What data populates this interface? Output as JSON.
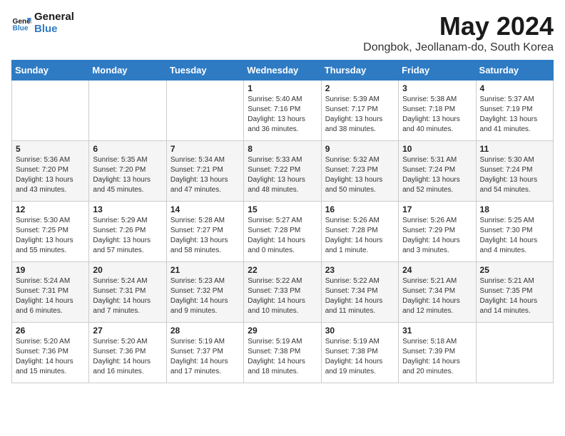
{
  "header": {
    "logo_line1": "General",
    "logo_line2": "Blue",
    "month": "May 2024",
    "location": "Dongbok, Jeollanam-do, South Korea"
  },
  "weekdays": [
    "Sunday",
    "Monday",
    "Tuesday",
    "Wednesday",
    "Thursday",
    "Friday",
    "Saturday"
  ],
  "weeks": [
    [
      {
        "day": "",
        "info": ""
      },
      {
        "day": "",
        "info": ""
      },
      {
        "day": "",
        "info": ""
      },
      {
        "day": "1",
        "info": "Sunrise: 5:40 AM\nSunset: 7:16 PM\nDaylight: 13 hours\nand 36 minutes."
      },
      {
        "day": "2",
        "info": "Sunrise: 5:39 AM\nSunset: 7:17 PM\nDaylight: 13 hours\nand 38 minutes."
      },
      {
        "day": "3",
        "info": "Sunrise: 5:38 AM\nSunset: 7:18 PM\nDaylight: 13 hours\nand 40 minutes."
      },
      {
        "day": "4",
        "info": "Sunrise: 5:37 AM\nSunset: 7:19 PM\nDaylight: 13 hours\nand 41 minutes."
      }
    ],
    [
      {
        "day": "5",
        "info": "Sunrise: 5:36 AM\nSunset: 7:20 PM\nDaylight: 13 hours\nand 43 minutes."
      },
      {
        "day": "6",
        "info": "Sunrise: 5:35 AM\nSunset: 7:20 PM\nDaylight: 13 hours\nand 45 minutes."
      },
      {
        "day": "7",
        "info": "Sunrise: 5:34 AM\nSunset: 7:21 PM\nDaylight: 13 hours\nand 47 minutes."
      },
      {
        "day": "8",
        "info": "Sunrise: 5:33 AM\nSunset: 7:22 PM\nDaylight: 13 hours\nand 48 minutes."
      },
      {
        "day": "9",
        "info": "Sunrise: 5:32 AM\nSunset: 7:23 PM\nDaylight: 13 hours\nand 50 minutes."
      },
      {
        "day": "10",
        "info": "Sunrise: 5:31 AM\nSunset: 7:24 PM\nDaylight: 13 hours\nand 52 minutes."
      },
      {
        "day": "11",
        "info": "Sunrise: 5:30 AM\nSunset: 7:24 PM\nDaylight: 13 hours\nand 54 minutes."
      }
    ],
    [
      {
        "day": "12",
        "info": "Sunrise: 5:30 AM\nSunset: 7:25 PM\nDaylight: 13 hours\nand 55 minutes."
      },
      {
        "day": "13",
        "info": "Sunrise: 5:29 AM\nSunset: 7:26 PM\nDaylight: 13 hours\nand 57 minutes."
      },
      {
        "day": "14",
        "info": "Sunrise: 5:28 AM\nSunset: 7:27 PM\nDaylight: 13 hours\nand 58 minutes."
      },
      {
        "day": "15",
        "info": "Sunrise: 5:27 AM\nSunset: 7:28 PM\nDaylight: 14 hours\nand 0 minutes."
      },
      {
        "day": "16",
        "info": "Sunrise: 5:26 AM\nSunset: 7:28 PM\nDaylight: 14 hours\nand 1 minute."
      },
      {
        "day": "17",
        "info": "Sunrise: 5:26 AM\nSunset: 7:29 PM\nDaylight: 14 hours\nand 3 minutes."
      },
      {
        "day": "18",
        "info": "Sunrise: 5:25 AM\nSunset: 7:30 PM\nDaylight: 14 hours\nand 4 minutes."
      }
    ],
    [
      {
        "day": "19",
        "info": "Sunrise: 5:24 AM\nSunset: 7:31 PM\nDaylight: 14 hours\nand 6 minutes."
      },
      {
        "day": "20",
        "info": "Sunrise: 5:24 AM\nSunset: 7:31 PM\nDaylight: 14 hours\nand 7 minutes."
      },
      {
        "day": "21",
        "info": "Sunrise: 5:23 AM\nSunset: 7:32 PM\nDaylight: 14 hours\nand 9 minutes."
      },
      {
        "day": "22",
        "info": "Sunrise: 5:22 AM\nSunset: 7:33 PM\nDaylight: 14 hours\nand 10 minutes."
      },
      {
        "day": "23",
        "info": "Sunrise: 5:22 AM\nSunset: 7:34 PM\nDaylight: 14 hours\nand 11 minutes."
      },
      {
        "day": "24",
        "info": "Sunrise: 5:21 AM\nSunset: 7:34 PM\nDaylight: 14 hours\nand 12 minutes."
      },
      {
        "day": "25",
        "info": "Sunrise: 5:21 AM\nSunset: 7:35 PM\nDaylight: 14 hours\nand 14 minutes."
      }
    ],
    [
      {
        "day": "26",
        "info": "Sunrise: 5:20 AM\nSunset: 7:36 PM\nDaylight: 14 hours\nand 15 minutes."
      },
      {
        "day": "27",
        "info": "Sunrise: 5:20 AM\nSunset: 7:36 PM\nDaylight: 14 hours\nand 16 minutes."
      },
      {
        "day": "28",
        "info": "Sunrise: 5:19 AM\nSunset: 7:37 PM\nDaylight: 14 hours\nand 17 minutes."
      },
      {
        "day": "29",
        "info": "Sunrise: 5:19 AM\nSunset: 7:38 PM\nDaylight: 14 hours\nand 18 minutes."
      },
      {
        "day": "30",
        "info": "Sunrise: 5:19 AM\nSunset: 7:38 PM\nDaylight: 14 hours\nand 19 minutes."
      },
      {
        "day": "31",
        "info": "Sunrise: 5:18 AM\nSunset: 7:39 PM\nDaylight: 14 hours\nand 20 minutes."
      },
      {
        "day": "",
        "info": ""
      }
    ]
  ]
}
